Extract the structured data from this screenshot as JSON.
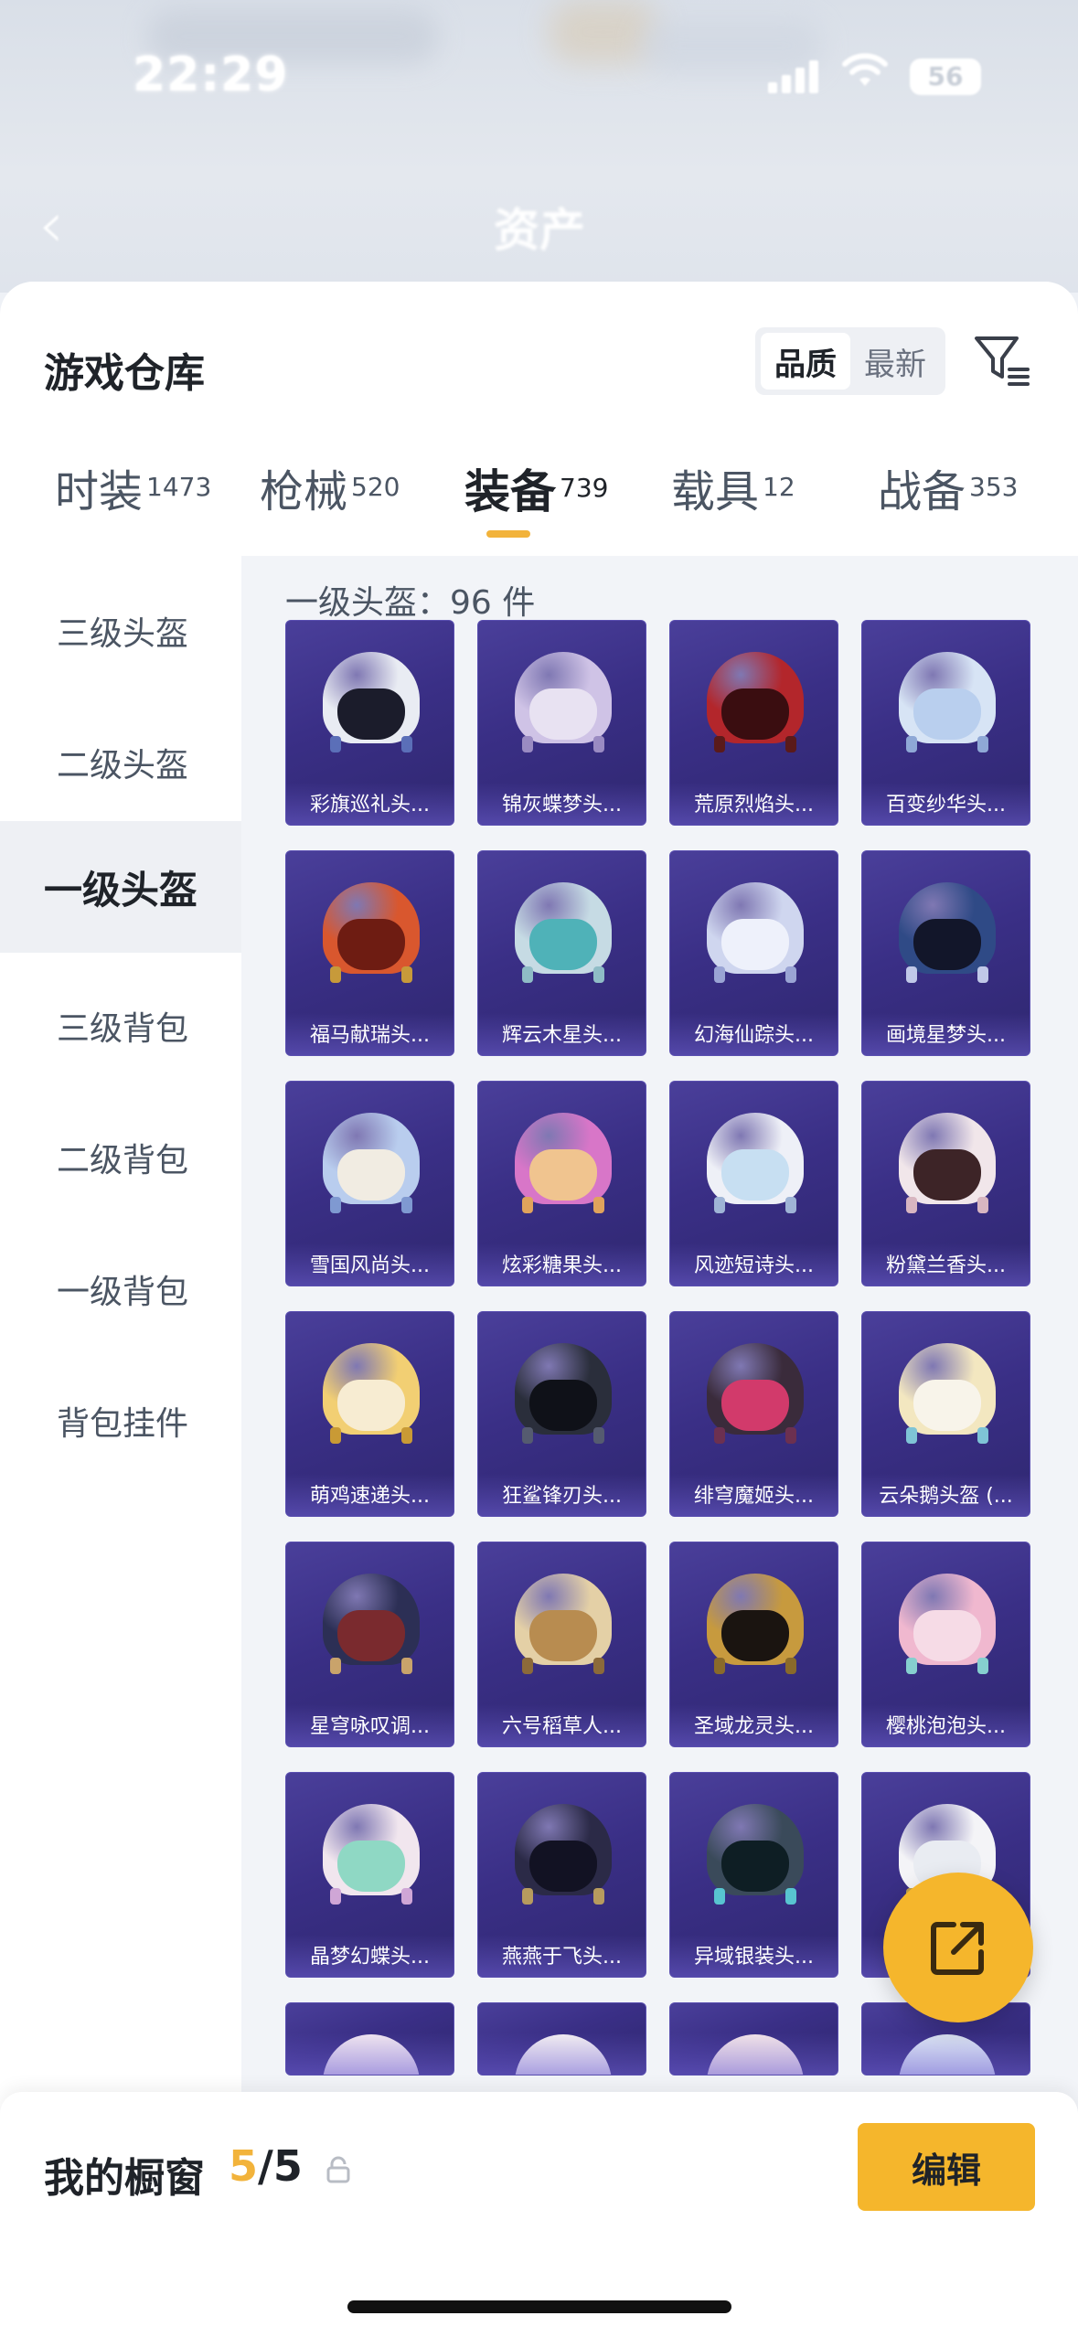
{
  "status_bar": {
    "time": "22:29",
    "battery": "56"
  },
  "nav": {
    "title": "资产",
    "ghost_left": "",
    "ghost_right": ""
  },
  "sheet": {
    "title": "游戏仓库",
    "sort_options": [
      {
        "label": "品质",
        "active": true
      },
      {
        "label": "最新",
        "active": false
      }
    ]
  },
  "tabs": [
    {
      "label": "时装",
      "count": "1473",
      "active": false
    },
    {
      "label": "枪械",
      "count": "520",
      "active": false
    },
    {
      "label": "装备",
      "count": "739",
      "active": true
    },
    {
      "label": "载具",
      "count": "12",
      "active": false
    },
    {
      "label": "战备",
      "count": "353",
      "active": false
    }
  ],
  "sidebar": {
    "items": [
      {
        "label": "三级头盔",
        "active": false
      },
      {
        "label": "二级头盔",
        "active": false
      },
      {
        "label": "一级头盔",
        "active": true
      },
      {
        "label": "三级背包",
        "active": false
      },
      {
        "label": "二级背包",
        "active": false
      },
      {
        "label": "一级背包",
        "active": false
      },
      {
        "label": "背包挂件",
        "active": false
      }
    ]
  },
  "content": {
    "header": "一级头盔：96 件",
    "items": [
      {
        "name": "彩旗巡礼头...",
        "dome": "#e9ecf3",
        "visor": "#1b1c2b",
        "strap": "#5b6fb8"
      },
      {
        "name": "锦灰蝶梦头...",
        "dome": "#cfc3e6",
        "visor": "#e8e2f2",
        "strap": "#9a8bc2"
      },
      {
        "name": "荒原烈焰头...",
        "dome": "#b3262b",
        "visor": "#3a0d10",
        "strap": "#5a1a1a"
      },
      {
        "name": "百变纱华头...",
        "dome": "#d7e4f5",
        "visor": "#b9cfee",
        "strap": "#8fa8d6"
      },
      {
        "name": "福马献瑞头...",
        "dome": "#d9572e",
        "visor": "#6e1c12",
        "strap": "#c79a3a"
      },
      {
        "name": "辉云木星头...",
        "dome": "#c6dbe4",
        "visor": "#4fb2b8",
        "strap": "#8fbcc6"
      },
      {
        "name": "幻海仙踪头...",
        "dome": "#cfd6ef",
        "visor": "#eef1fb",
        "strap": "#9aa4d4"
      },
      {
        "name": "画境星梦头...",
        "dome": "#2f4a86",
        "visor": "#12162a",
        "strap": "#c0c8e8"
      },
      {
        "name": "雪国风尚头...",
        "dome": "#b9cdee",
        "visor": "#f1ece2",
        "strap": "#7f99d1"
      },
      {
        "name": "炫彩糖果头...",
        "dome": "#d876c8",
        "visor": "#f0c48f",
        "strap": "#e0a35c"
      },
      {
        "name": "风迹短诗头...",
        "dome": "#eef0f7",
        "visor": "#c7dff2",
        "strap": "#9fb4d6"
      },
      {
        "name": "粉黛兰香头...",
        "dome": "#f1e6ea",
        "visor": "#3d2427",
        "strap": "#d8b6c1"
      },
      {
        "name": "萌鸡速递头...",
        "dome": "#f2cf73",
        "visor": "#f7ecd2",
        "strap": "#c99a35"
      },
      {
        "name": "狂鲨锋刃头...",
        "dome": "#2a2e3b",
        "visor": "#0f1118",
        "strap": "#555b70"
      },
      {
        "name": "绯穹魔姬头...",
        "dome": "#3a2b3b",
        "visor": "#d23a6b",
        "strap": "#6c3050"
      },
      {
        "name": "云朵鹅头盔 (...",
        "dome": "#f3e7c0",
        "visor": "#f8f4ea",
        "strap": "#7fc4d6"
      },
      {
        "name": "星穹咏叹调...",
        "dome": "#2c2f55",
        "visor": "#7a2a2e",
        "strap": "#c9a36b"
      },
      {
        "name": "六号稻草人...",
        "dome": "#e4d0a6",
        "visor": "#b88c50",
        "strap": "#8c6a3a"
      },
      {
        "name": "圣域龙灵头...",
        "dome": "#c79a3e",
        "visor": "#1a1410",
        "strap": "#8a6a2a"
      },
      {
        "name": "樱桃泡泡头...",
        "dome": "#f0b8cf",
        "visor": "#f6dbe6",
        "strap": "#86cfcf"
      },
      {
        "name": "晶梦幻蝶头...",
        "dome": "#f1e6ee",
        "visor": "#8fd8c4",
        "strap": "#cfa6d6"
      },
      {
        "name": "燕燕于飞头...",
        "dome": "#2b2a47",
        "visor": "#121223",
        "strap": "#b79b5e"
      },
      {
        "name": "异域银装头...",
        "dome": "#3a4a5a",
        "visor": "#0e1e24",
        "strap": "#58c4d0"
      },
      {
        "name": "",
        "dome": "#f4f4f7",
        "visor": "#e9ecf2",
        "strap": "#c0a24c"
      }
    ],
    "peek_items": [
      {
        "dome": "#f1e6f0"
      },
      {
        "dome": "#f3eef2"
      },
      {
        "dome": "#f3e4e8"
      },
      {
        "dome": "#dde6f4"
      }
    ]
  },
  "bottom_bar": {
    "title": "我的橱窗",
    "current": "5",
    "total": "/5",
    "edit_label": "编辑"
  },
  "colors": {
    "accent": "#f5b62c",
    "card_bg": "#3a2f86"
  }
}
